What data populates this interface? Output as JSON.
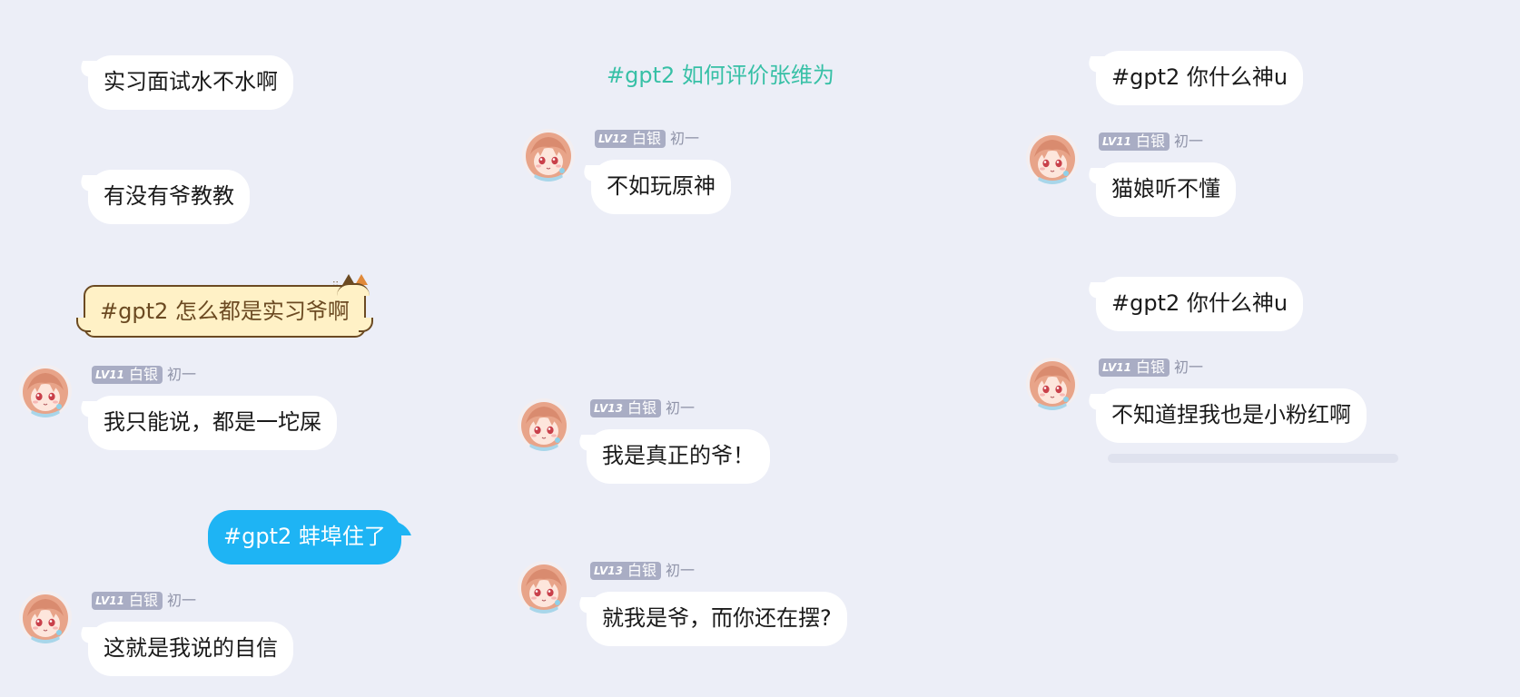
{
  "colors": {
    "background": "#eceef7",
    "bubble": "#ffffff",
    "self_bubble": "#1eb4f4",
    "topic_text": "#37c0a6",
    "badge": "#a9adc4",
    "cat_bubble": "#fff1c6"
  },
  "columns": [
    {
      "messages": [
        {
          "text": "实习面试水不水啊"
        },
        {
          "text": "有没有爷教教"
        },
        {
          "text": "#gpt2 怎么都是实习爷啊",
          "style": "cat-bubble"
        },
        {
          "level": "LV11",
          "title": "白银",
          "nickname": "初一",
          "text": "我只能说，都是一坨屎"
        },
        {
          "text": "#gpt2 蚌埠住了",
          "style": "self"
        },
        {
          "level": "LV11",
          "title": "白银",
          "nickname": "初一",
          "text": "这就是我说的自信"
        }
      ]
    },
    {
      "topic": "#gpt2 如何评价张维为",
      "messages": [
        {
          "level": "LV12",
          "title": "白银",
          "nickname": "初一",
          "text": "不如玩原神"
        },
        {
          "level": "LV13",
          "title": "白银",
          "nickname": "初一",
          "text": "我是真正的爷！"
        },
        {
          "level": "LV13",
          "title": "白银",
          "nickname": "初一",
          "text": "就我是爷，而你还在摆?"
        }
      ]
    },
    {
      "messages": [
        {
          "text": "#gpt2 你什么神u"
        },
        {
          "level": "LV11",
          "title": "白银",
          "nickname": "初一",
          "text": "猫娘听不懂"
        },
        {
          "text": "#gpt2 你什么神u"
        },
        {
          "level": "LV11",
          "title": "白银",
          "nickname": "初一",
          "text": "不知道捏我也是小粉红啊"
        }
      ]
    }
  ],
  "icons": {
    "avatar": "anime-girl-avatar-icon",
    "cat_ears": "cat-ears-icon"
  }
}
